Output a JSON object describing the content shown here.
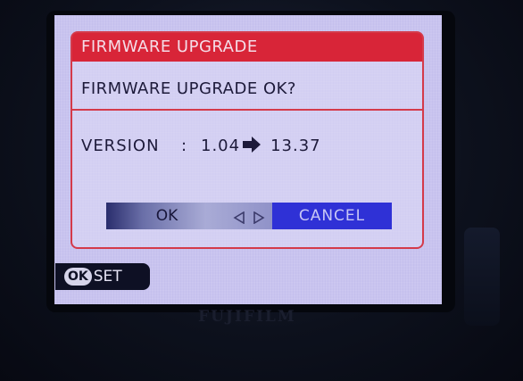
{
  "dialog": {
    "title": "FIRMWARE UPGRADE",
    "question": "FIRMWARE UPGRADE OK?",
    "version_label": "VERSION",
    "separator": ":",
    "current_version": "1.04",
    "new_version": "13.37",
    "arrow_icon": "right-arrow-icon",
    "ok_label": "OK",
    "cancel_label": "CANCEL",
    "selected_button": "CANCEL",
    "nav_icon": "left-right-arrows-icon"
  },
  "footer": {
    "ok_key": "OK",
    "set_label": "SET"
  },
  "colors": {
    "title_bar": "#d82538",
    "border": "#d43a4a",
    "screen_background": "#c9c4ef",
    "selected_button": "#2f31d6"
  }
}
